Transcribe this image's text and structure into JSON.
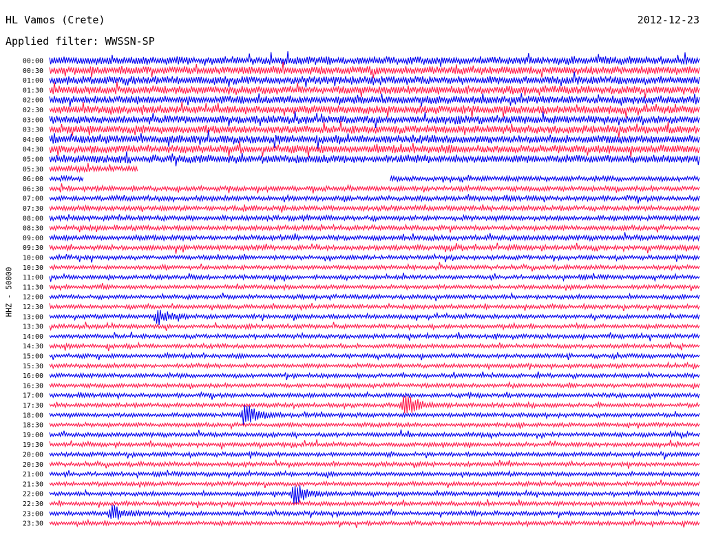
{
  "header": {
    "station": "HL Vamos (Crete)",
    "date": "2012-12-23",
    "filter": "Applied filter: WWSSN-SP"
  },
  "chart_data": {
    "type": "line",
    "ylabel": "HHZ - 50000",
    "row_labels": [
      "00:00",
      "00:30",
      "01:00",
      "01:30",
      "02:00",
      "02:30",
      "03:00",
      "03:30",
      "04:00",
      "04:30",
      "05:00",
      "05:30",
      "06:00",
      "06:30",
      "07:00",
      "07:30",
      "08:00",
      "08:30",
      "09:00",
      "09:30",
      "10:00",
      "10:30",
      "11:00",
      "11:30",
      "12:00",
      "12:30",
      "13:00",
      "13:30",
      "14:00",
      "14:30",
      "15:00",
      "15:30",
      "16:00",
      "16:30",
      "17:00",
      "17:30",
      "18:00",
      "18:30",
      "19:00",
      "19:30",
      "20:00",
      "20:30",
      "21:00",
      "21:30",
      "22:00",
      "22:30",
      "23:00",
      "23:30"
    ],
    "series_colors": [
      "#0000ee",
      "#ff1a4a"
    ],
    "row_minutes": 30,
    "noise_amplitude_rel": [
      1.6,
      1.6,
      1.6,
      1.6,
      1.6,
      1.6,
      1.6,
      1.6,
      1.6,
      1.6,
      1.6,
      1.2,
      1.0,
      1.0,
      1.0,
      1.0,
      1.0,
      1.0,
      1.0,
      1.0,
      0.85,
      0.85,
      0.85,
      0.85,
      0.85,
      0.85,
      0.85,
      0.85,
      0.85,
      0.85,
      0.85,
      0.85,
      0.85,
      0.85,
      0.85,
      0.85,
      0.85,
      0.85,
      0.85,
      0.85,
      0.85,
      0.85,
      0.85,
      0.85,
      0.85,
      0.85,
      0.85,
      0.85
    ],
    "gaps": [
      {
        "row": 11,
        "start_min": 4.1,
        "end_min": 30
      },
      {
        "row": 12,
        "start_min": 1.6,
        "end_min": 15.7
      }
    ],
    "events": [
      {
        "row": 26,
        "minute": 5.0,
        "amp": 3.5
      },
      {
        "row": 35,
        "minute": 16.4,
        "amp": 6.0
      },
      {
        "row": 36,
        "minute": 9.0,
        "amp": 5.5
      },
      {
        "row": 44,
        "minute": 11.3,
        "amp": 5.5
      },
      {
        "row": 46,
        "minute": 2.9,
        "amp": 4.5
      }
    ]
  }
}
